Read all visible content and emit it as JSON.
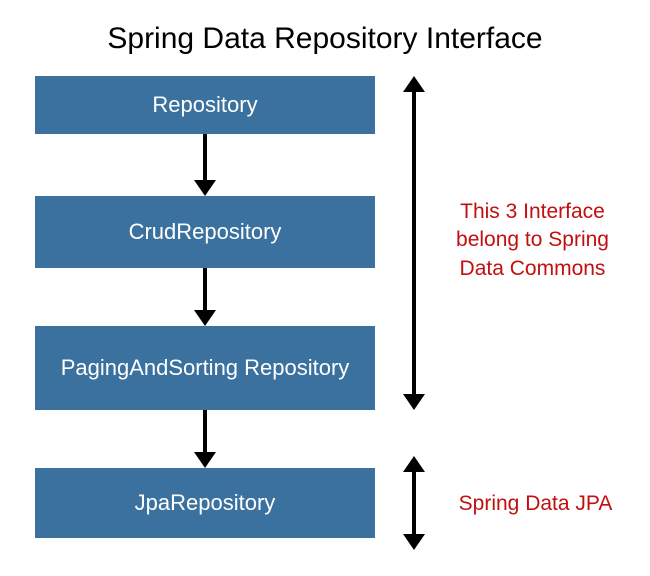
{
  "title": "Spring Data Repository Interface",
  "boxes": [
    {
      "label": "Repository"
    },
    {
      "label": "CrudRepository"
    },
    {
      "label": "PagingAndSorting Repository"
    },
    {
      "label": "JpaRepository"
    }
  ],
  "annotations": {
    "group1": "This 3 Interface belong to Spring Data Commons",
    "group2": "Spring Data JPA"
  },
  "colors": {
    "boxFill": "#3b719e",
    "boxText": "#ffffff",
    "annotationText": "#c20f0f",
    "arrow": "#000000"
  }
}
